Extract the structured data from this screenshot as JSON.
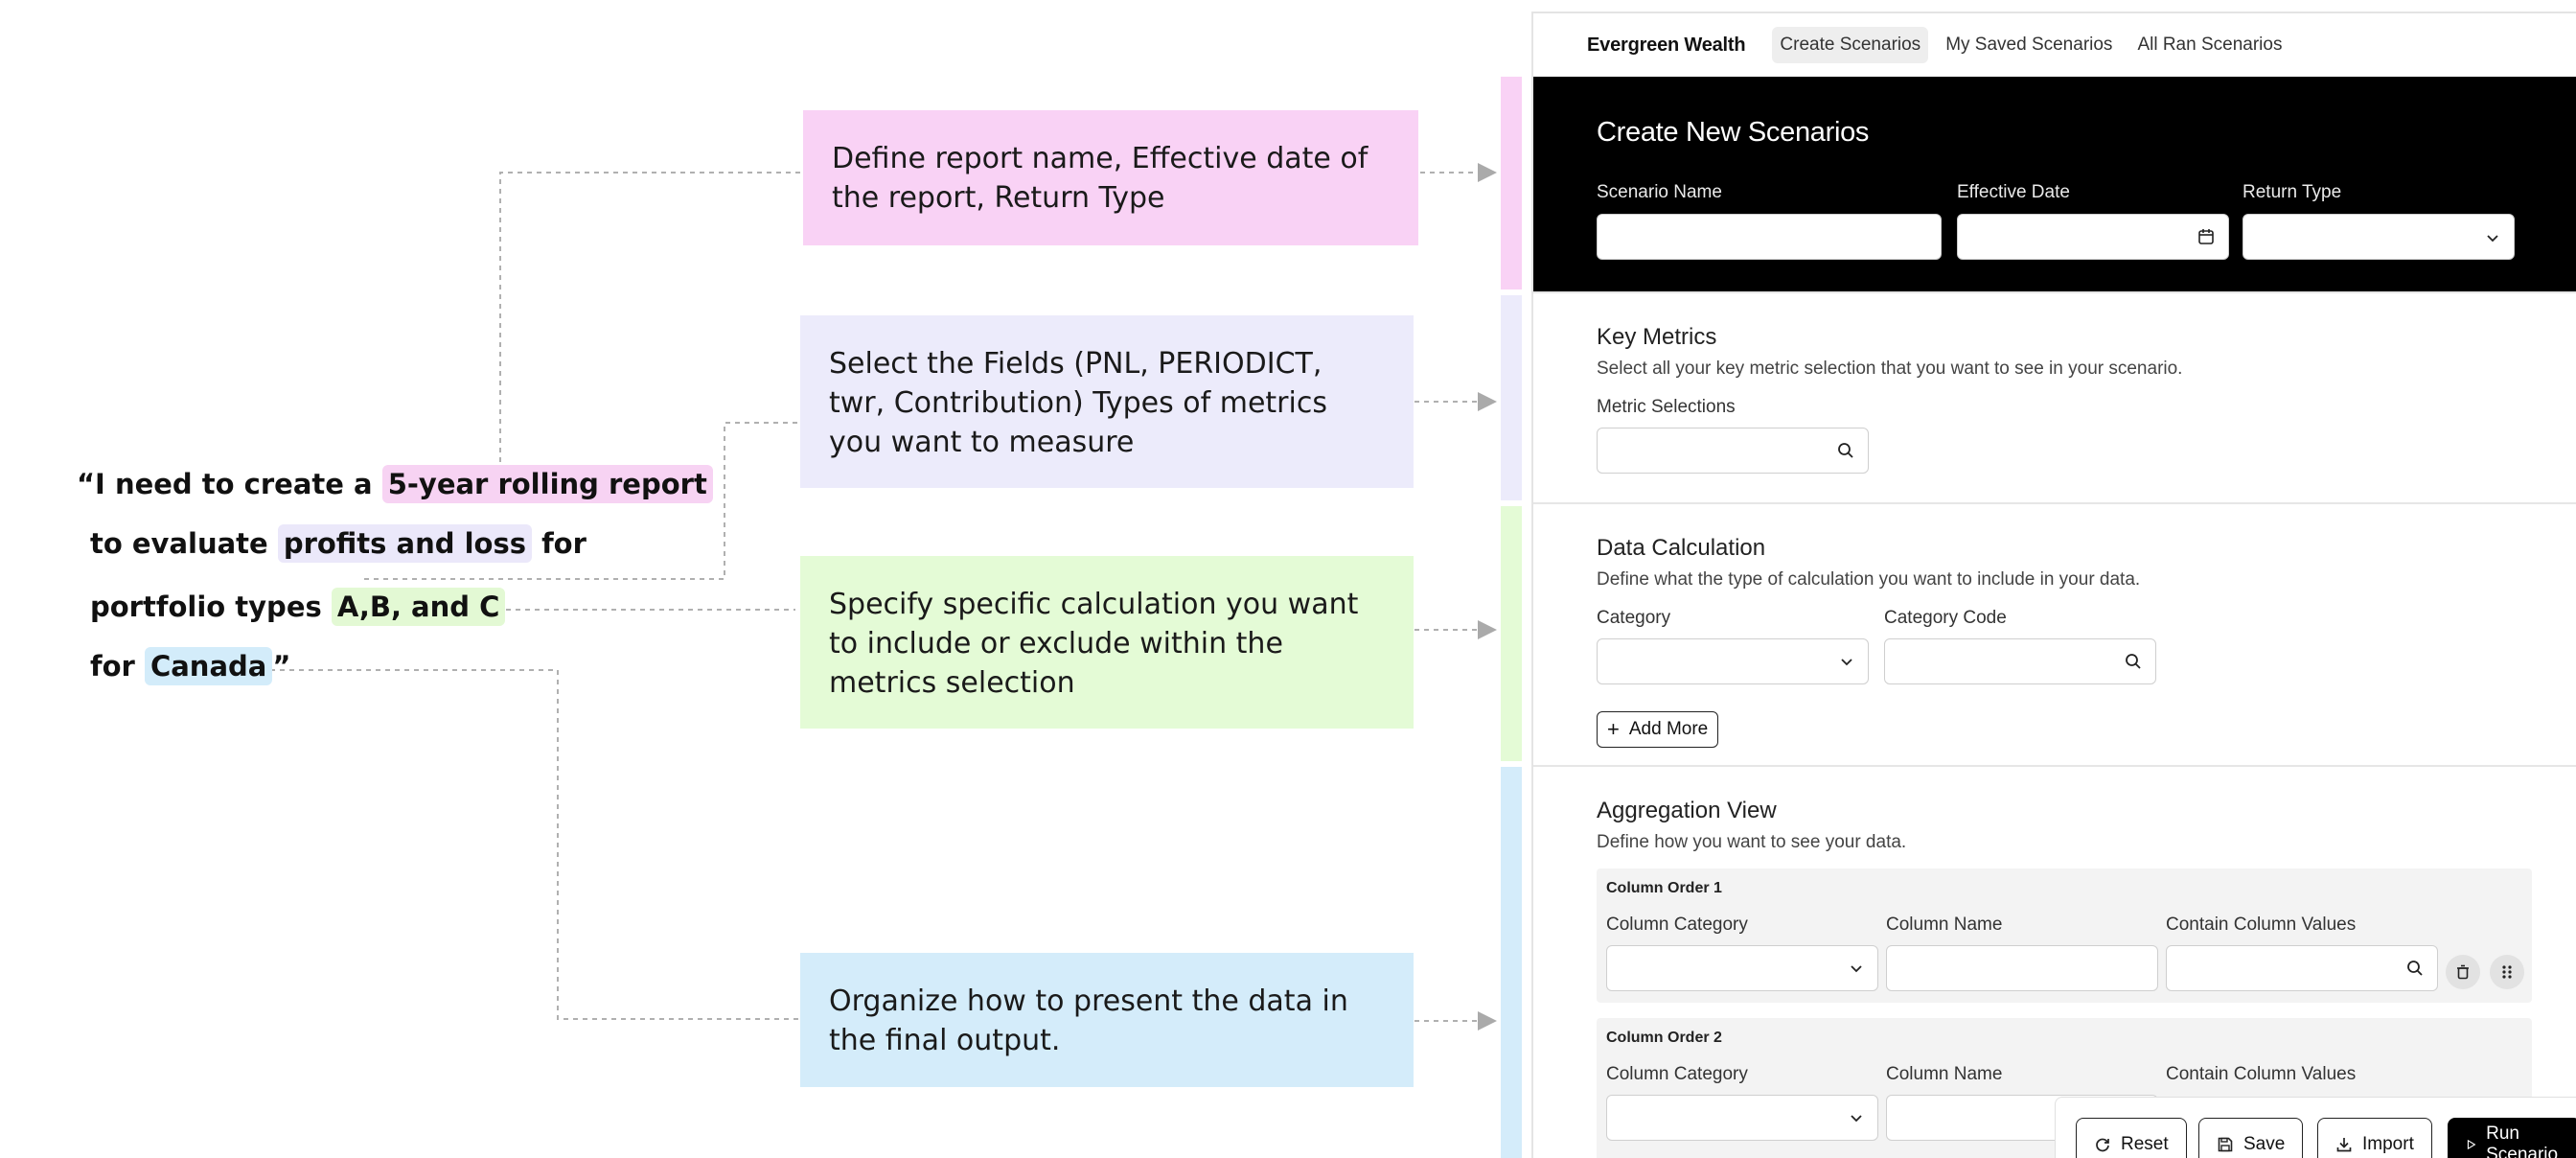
{
  "quote": {
    "line1_pre": "“I need to create a ",
    "line1_hl": "5-year rolling report",
    "line2_pre": "to evaluate ",
    "line2_hl": "profits and loss",
    "line2_post": " for",
    "line3_pre": "portfolio types ",
    "line3_hl": "A,B, and C",
    "line4_pre": "for ",
    "line4_hl": "Canada",
    "line4_post": "”"
  },
  "notes": {
    "n1": "Define report name, Effective date of the report, Return Type",
    "n2": "Select the Fields (PNL, PERIODICT, twr, Contribution) Types of metrics you want to measure",
    "n3": "Specify specific calculation you want to include or exclude within the metrics selection",
    "n4": "Organize how to present the data in the final output."
  },
  "colors": {
    "pink": "#f9d2f5",
    "lavender": "#ecebfb",
    "green": "#e4fbd6",
    "blue": "#d4ecfa"
  },
  "nav": {
    "brand": "Evergreen Wealth",
    "tabs": [
      "Create Scenarios",
      "My Saved Scenarios",
      "All Ran Scenarios"
    ]
  },
  "hero": {
    "title": "Create New Scenarios",
    "scenario_label": "Scenario Name",
    "date_label": "Effective Date",
    "return_label": "Return Type"
  },
  "key_metrics": {
    "title": "Key Metrics",
    "subtitle": "Select all your key metric selection that you want to see in your scenario.",
    "field_label": "Metric Selections"
  },
  "data_calc": {
    "title": "Data Calculation",
    "subtitle": "Define what the type of calculation you want to include in your data.",
    "category_label": "Category",
    "code_label": "Category Code",
    "add_more": "Add More"
  },
  "aggregation": {
    "title": "Aggregation View",
    "subtitle": "Define how you want to see your data.",
    "columns": [
      {
        "title": "Column Order 1",
        "cat_label": "Column Category",
        "name_label": "Column Name",
        "values_label": "Contain Column Values"
      },
      {
        "title": "Column Order 2",
        "cat_label": "Column Category",
        "name_label": "Column Name",
        "values_label": "Contain Column Values"
      }
    ]
  },
  "footer": {
    "reset": "Reset",
    "save": "Save",
    "import": "Import",
    "run": "Run Scenario"
  }
}
